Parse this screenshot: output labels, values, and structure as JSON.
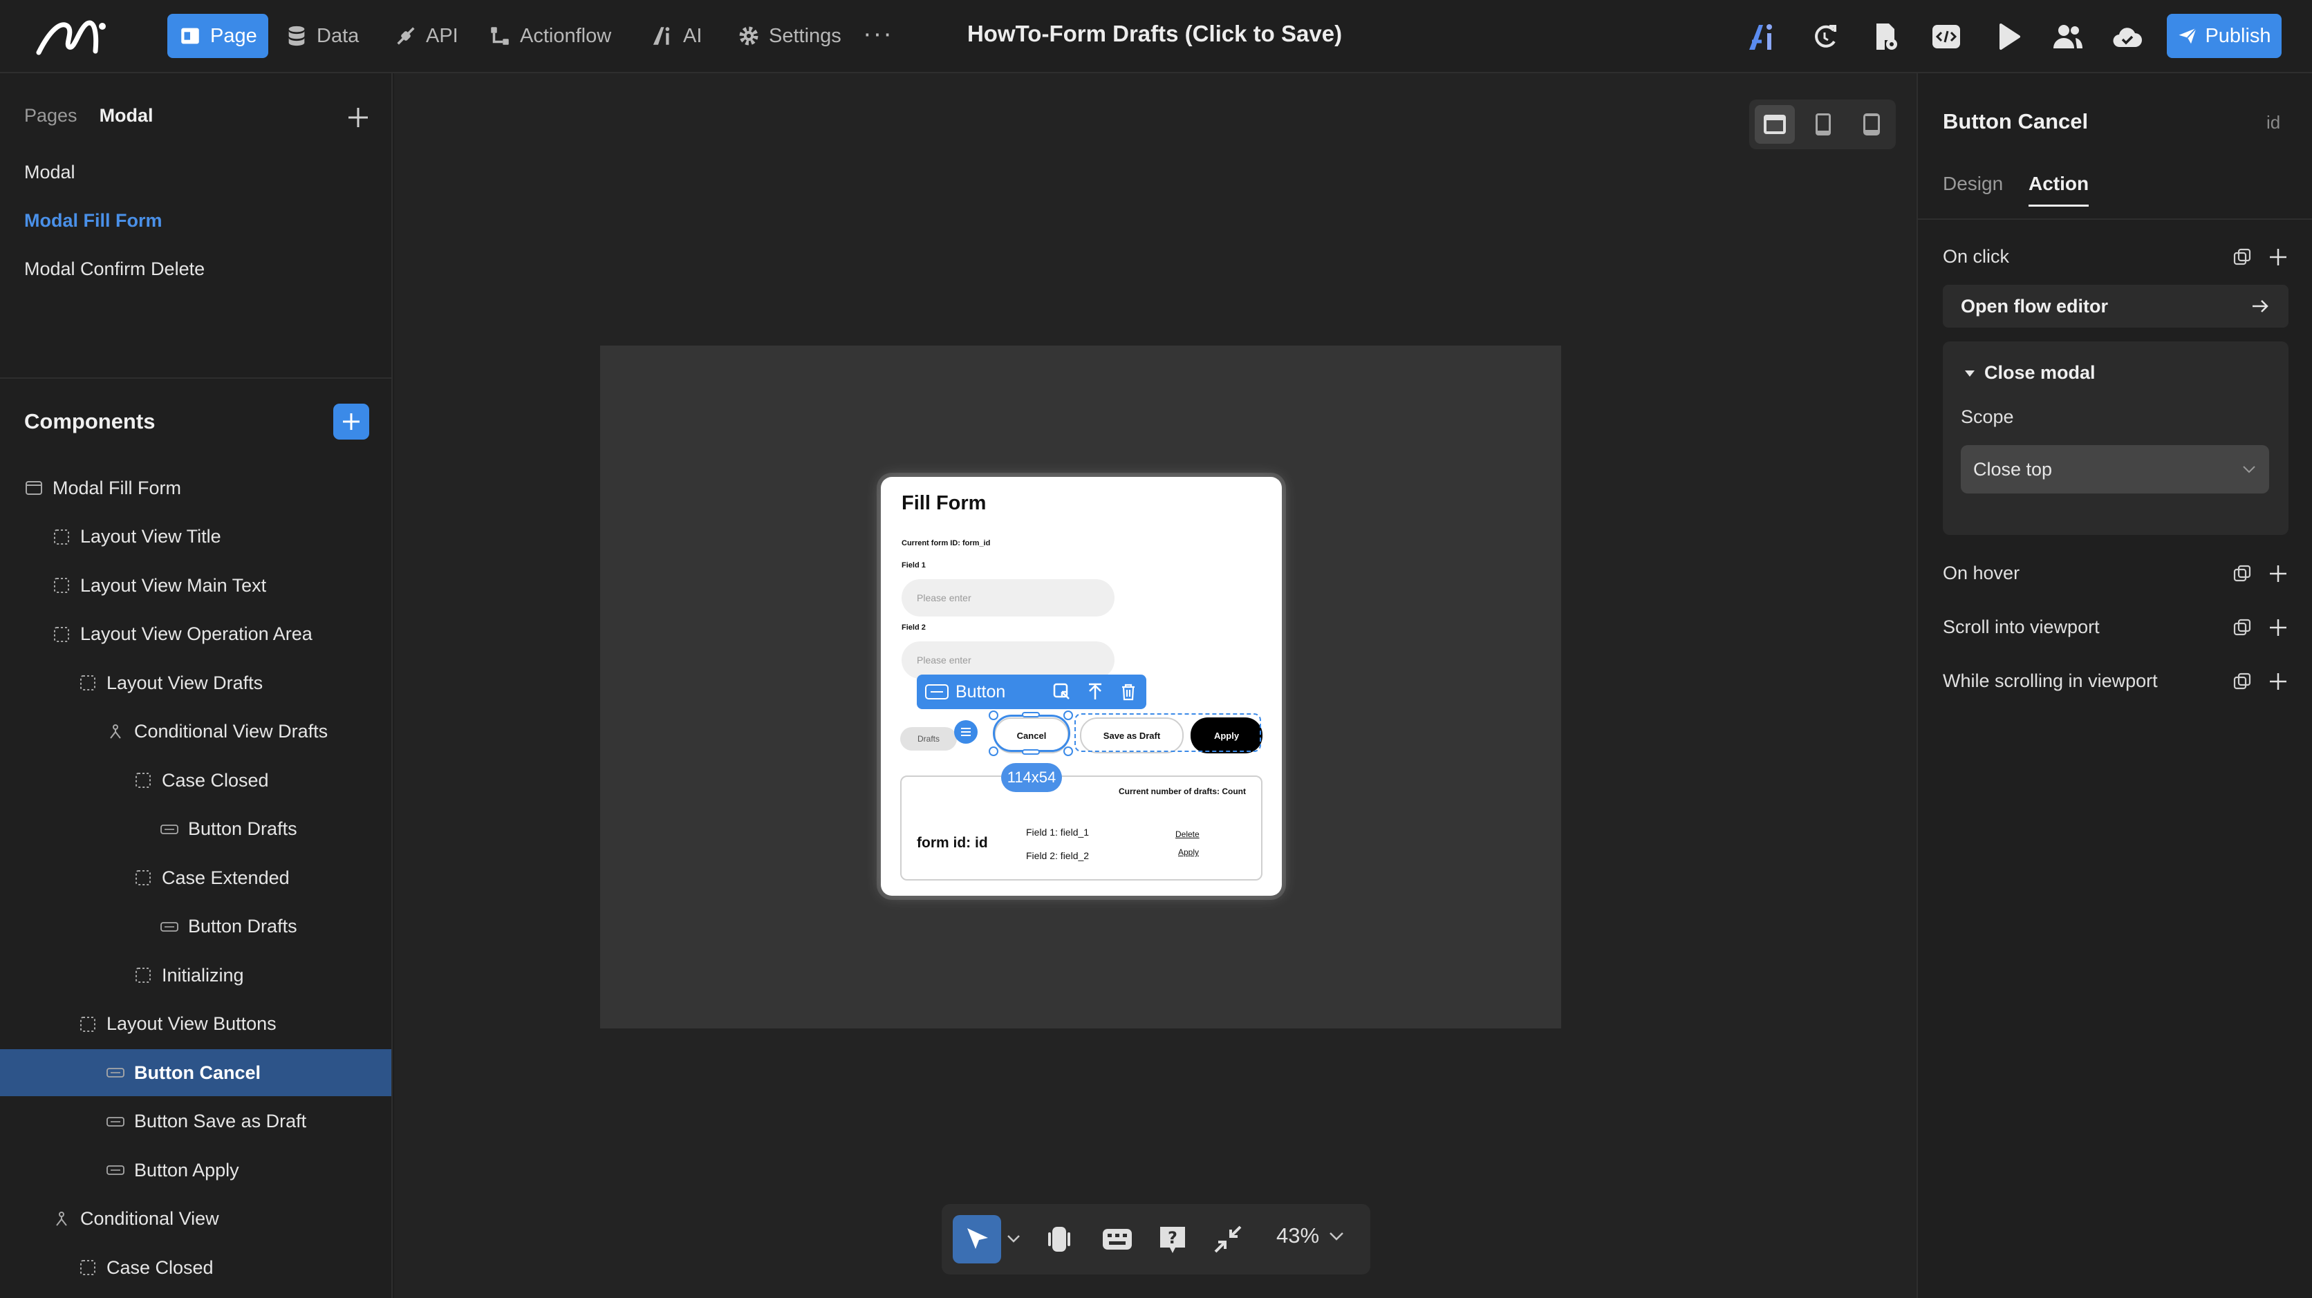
{
  "topbar": {
    "nav": [
      {
        "label": "Page",
        "icon": "page-icon"
      },
      {
        "label": "Data",
        "icon": "database-icon"
      },
      {
        "label": "API",
        "icon": "api-icon"
      },
      {
        "label": "Actionflow",
        "icon": "actionflow-icon"
      },
      {
        "label": "AI",
        "icon": "ai-icon"
      },
      {
        "label": "Settings",
        "icon": "gear-icon"
      }
    ],
    "more": "···",
    "title": "HowTo-Form Drafts (Click to Save)",
    "publish_label": "Publish",
    "accent": "#3b8ae8"
  },
  "left": {
    "tabs": [
      "Pages",
      "Modal"
    ],
    "pages": [
      "Modal",
      "Modal Fill Form",
      "Modal Confirm Delete"
    ],
    "selected_page": "Modal Fill Form",
    "components_title": "Components",
    "tree": [
      {
        "label": "Modal Fill Form",
        "icon": "modal-icon"
      },
      {
        "label": "Layout View Title",
        "icon": "layout-icon"
      },
      {
        "label": "Layout View Main Text",
        "icon": "layout-icon"
      },
      {
        "label": "Layout View Operation Area",
        "icon": "layout-icon"
      },
      {
        "label": "Layout View Drafts",
        "icon": "layout-icon"
      },
      {
        "label": "Conditional View Drafts",
        "icon": "conditional-icon"
      },
      {
        "label": "Case Closed",
        "icon": "layout-icon"
      },
      {
        "label": "Button Drafts",
        "icon": "button-icon"
      },
      {
        "label": "Case Extended",
        "icon": "layout-icon"
      },
      {
        "label": "Button Drafts",
        "icon": "button-icon"
      },
      {
        "label": "Initializing",
        "icon": "layout-icon"
      },
      {
        "label": "Layout View Buttons",
        "icon": "layout-icon"
      },
      {
        "label": "Button Cancel",
        "icon": "button-icon"
      },
      {
        "label": "Button Save as Draft",
        "icon": "button-icon"
      },
      {
        "label": "Button Apply",
        "icon": "button-icon"
      },
      {
        "label": "Conditional View",
        "icon": "conditional-icon"
      },
      {
        "label": "Case Closed",
        "icon": "layout-icon"
      }
    ],
    "selected_tree_item": "Button Cancel"
  },
  "canvas": {
    "modal": {
      "title": "Fill Form",
      "form_id_text": "Current form ID: form_id",
      "field1_label": "Field 1",
      "field1_placeholder": "Please enter",
      "field2_label": "Field 2",
      "field2_placeholder": "Please enter",
      "drafts_btn": "Drafts",
      "cancel_btn": "Cancel",
      "save_draft_btn": "Save as Draft",
      "apply_btn": "Apply",
      "count_text": "Current number of drafts: Count",
      "draft_id": "form id: id",
      "draft_field1": "Field 1:  field_1",
      "draft_field2": "Field 2: field_2",
      "delete_link": "Delete",
      "apply_link": "Apply"
    },
    "floating_toolbar_label": "Button",
    "size_tag": "114x54",
    "zoom": "43%"
  },
  "right": {
    "component_title": "Button Cancel",
    "id_label": "id",
    "tabs": [
      "Design",
      "Action"
    ],
    "active_tab": "Action",
    "on_click": "On click",
    "open_flow_editor": "Open flow editor",
    "action_name": "Close modal",
    "scope_label": "Scope",
    "scope_value": "Close top",
    "events": [
      "On hover",
      "Scroll into viewport",
      "While scrolling in viewport"
    ]
  }
}
